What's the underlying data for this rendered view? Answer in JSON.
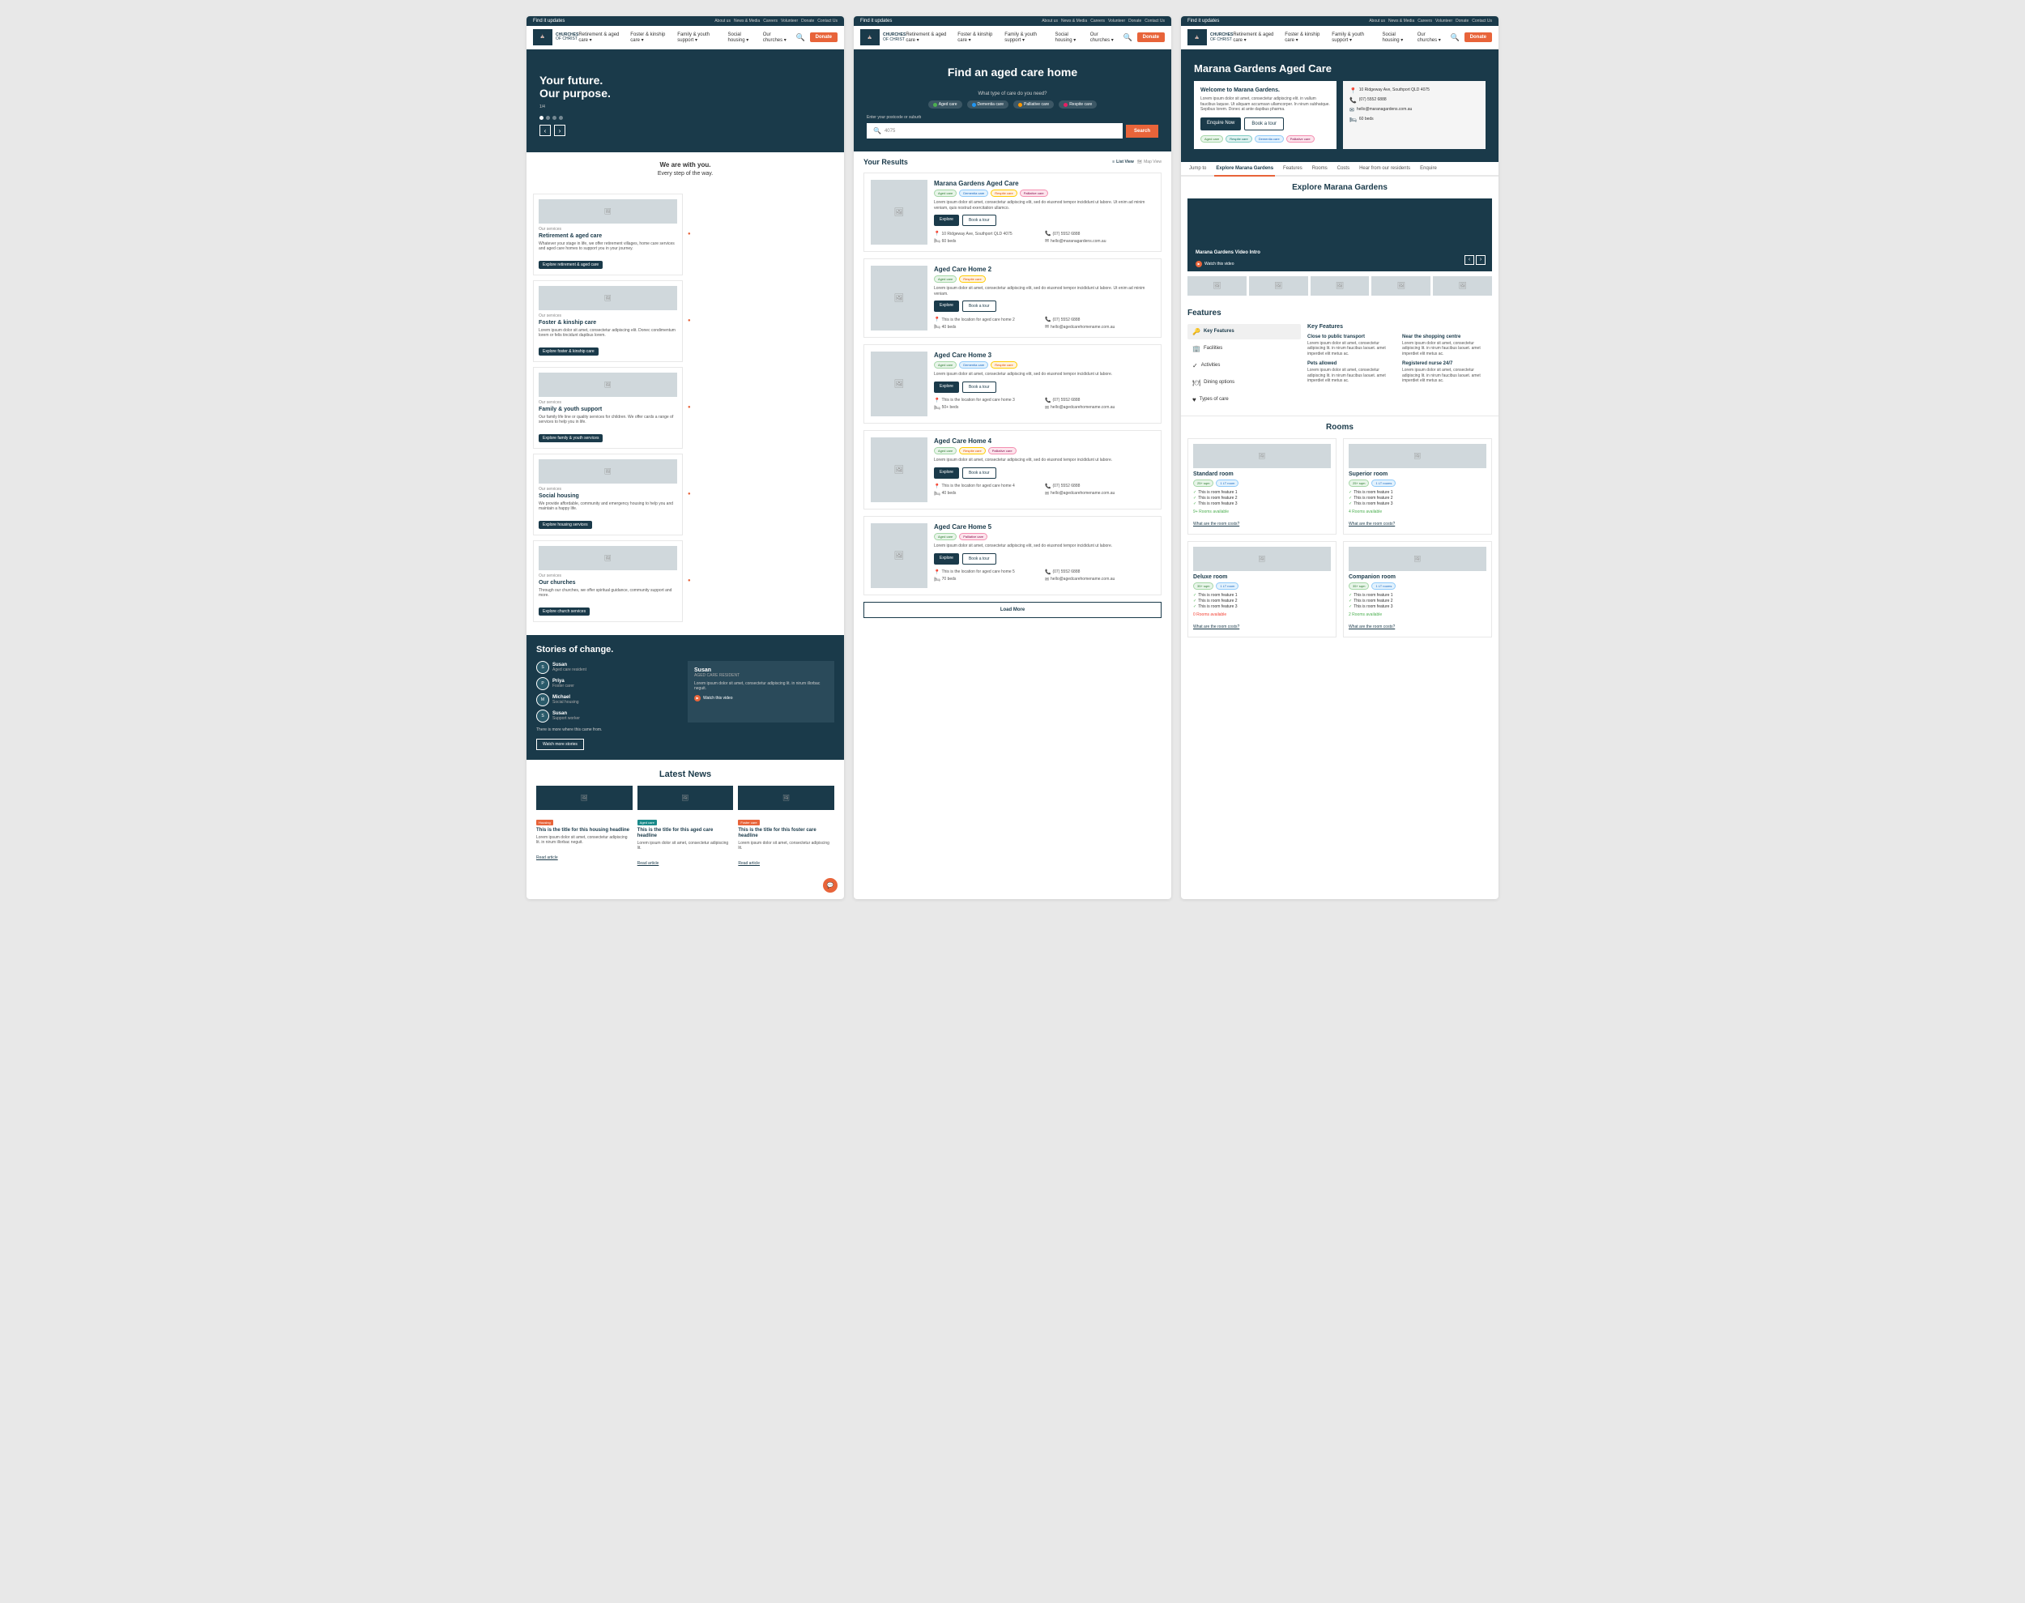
{
  "site": {
    "logo_text": "CHURCHES\nOF\nCHRIST",
    "nav_links": [
      "About us",
      "News & Media",
      "Careers",
      "Volunteer",
      "Donate",
      "Contact Us"
    ],
    "donate_btn": "Donate"
  },
  "panel1": {
    "top_bar": "Find it updates",
    "hero_title_line1": "Your future.",
    "hero_title_line2": "Our purpose.",
    "tagline_line1": "We are with you.",
    "tagline_line2": "Every step of the way.",
    "services": [
      {
        "label": "Our services",
        "title": "Retirement & aged care",
        "text": "Whatever your stage in life, we offer retirement villages, home care services and aged care homes to support you in your journey.",
        "btn": "Explore retirement & aged care"
      },
      {
        "label": "Our services",
        "title": "Foster & kinship care",
        "text": "Lorem ipsum dolor sit amet, consectetur adipiscing elit. Donec condimentum lorem or felis tincidunt dapibus lorem.",
        "btn": "Explore foster & kinship care"
      },
      {
        "label": "Our services",
        "title": "Family & youth support",
        "text": "Our family life line or quality services for children. We offer cards a range of services to help you in life.",
        "btn": "Explore family & youth services"
      },
      {
        "label": "Our services",
        "title": "Social housing",
        "text": "We provide affordable, community and emergency housing to help you and maintain a happy life.",
        "btn": "Explore housing services"
      },
      {
        "label": "Our services",
        "title": "Our churches",
        "text": "Through our churches, we offer spiritual guidance, community support and more.",
        "btn": "Explore church services"
      }
    ],
    "stories_title": "Stories of change.",
    "stories": [
      {
        "name": "Susan",
        "role": "Aged care resident"
      },
      {
        "name": "Priya",
        "role": "Foster carer"
      },
      {
        "name": "Michael",
        "role": "Social housing"
      },
      {
        "name": "Susan",
        "role": "Support worker"
      }
    ],
    "featured_story": {
      "name": "Susan",
      "role": "AGED CARE RESIDENT",
      "text": "Lorem ipsum dolor sit amet, consectetur adipiscing lit. in nirum illorbac neguit.",
      "watch_label": "Watch this video"
    },
    "more_stories_btn": "Watch more stories",
    "news_title": "Latest News",
    "news": [
      {
        "badge": "Housing",
        "badge_color": "orange",
        "headline": "This is the title for this housing headline",
        "text": "Lorem ipsum dolor sit amet, consectetur adipiscing lit. in nirum illorbac neguit.",
        "read_more": "Read article"
      },
      {
        "badge": "Aged care",
        "badge_color": "teal",
        "headline": "This is the title for this aged care headline",
        "text": "Lorem ipsum dolor sit amet, consectetur adipiscing lit.",
        "read_more": "Read article"
      },
      {
        "badge": "Foster care",
        "badge_color": "orange",
        "headline": "This is the title for this foster care headline",
        "text": "Lorem ipsum dolor sit amet, consectetur adipiscing lit.",
        "read_more": "Read article"
      }
    ]
  },
  "panel2": {
    "top_bar": "Find it updates",
    "hero_title": "Find an aged care home",
    "care_types": [
      "Aged care",
      "Dementia care",
      "Palliative care",
      "Respite care"
    ],
    "search_label": "Enter your postcode or suburb",
    "search_placeholder": "4075",
    "search_btn": "Search",
    "results_title": "Your Results",
    "view_list": "List View",
    "view_map": "Map View",
    "results": [
      {
        "title": "Marana Gardens Aged Care",
        "tags": [
          "Aged care",
          "Dementia care",
          "Respite care",
          "Palliative care"
        ],
        "text": "Lorem ipsum dolor sit amet, consectetur adipiscing elit, sed do eiusmod tempor incididunt ut labore. Ut enim ad minim veniam, quis nostrud exercitation ullamco.",
        "address": "10 Ridgeway Ave, Southport QLD 4075",
        "phone": "(07) 5552 6888",
        "email": "hello@maranagardens.com.au",
        "beds": "60 beds",
        "explore_btn": "Explore",
        "tour_btn": "Book a tour"
      },
      {
        "title": "Aged Care Home 2",
        "tags": [
          "Aged care",
          "Respite care"
        ],
        "text": "Lorem ipsum dolor sit amet, consectetur adipiscing elit, sed do eiusmod tempor incididunt ut labore. Ut enim ad minim veniam.",
        "address": "This is the location for aged care home 2",
        "phone": "(07) 5552 6888",
        "email": "hello@agedcarehomename.com.au",
        "beds": "40 beds",
        "explore_btn": "Explore",
        "tour_btn": "Book a tour"
      },
      {
        "title": "Aged Care Home 3",
        "tags": [
          "Aged care",
          "Dementia care",
          "Respite care"
        ],
        "text": "Lorem ipsum dolor sit amet, consectetur adipiscing elit, sed do eiusmod tempor incididunt ut labore.",
        "address": "This is the location for aged care home 3",
        "phone": "(07) 5552 6888",
        "email": "hello@agedcarehomename.com.au",
        "beds": "50+ beds",
        "explore_btn": "Explore",
        "tour_btn": "Book a tour"
      },
      {
        "title": "Aged Care Home 4",
        "tags": [
          "Aged care",
          "Respite care",
          "Palliative care"
        ],
        "text": "Lorem ipsum dolor sit amet, consectetur adipiscing elit, sed do eiusmod tempor incididunt ut labore.",
        "address": "This is the location for aged care home 4",
        "phone": "(07) 5552 6888",
        "email": "hello@agedcarehomename.com.au",
        "beds": "40 beds",
        "explore_btn": "Explore",
        "tour_btn": "Book a tour"
      },
      {
        "title": "Aged Care Home 5",
        "tags": [
          "Aged care",
          "Palliative care"
        ],
        "text": "Lorem ipsum dolor sit amet, consectetur adipiscing elit, sed do eiusmod tempor incididunt ut labore.",
        "address": "This is the location for aged care home 5",
        "phone": "(07) 5552 6888",
        "email": "hello@agedcarehomename.com.au",
        "beds": "70 beds",
        "explore_btn": "Explore",
        "tour_btn": "Book a tour"
      }
    ],
    "load_more_btn": "Load More"
  },
  "panel3": {
    "top_bar": "Find it updates",
    "detail_title": "Marana Gardens Aged Care",
    "welcome_title": "Welcome to Marana Gardens.",
    "welcome_text": "Lorem ipsum dolor sit amet, consectetur adipiscing elit. in vallum faucibus laquse. Ut aliquam accumsan ullamcorper. In nirum subhatque. Sepibus lorem. Donec at ante dapibus pharma.",
    "address": "10 Ridgeway Ave, Southport QLD 4075",
    "phone": "(07) 5552 6888",
    "email": "hello@maranagardens.com.au",
    "beds": "60 beds",
    "enquire_btn": "Enquire Now",
    "book_btn": "Book a tour",
    "care_tags": [
      "Aged care",
      "Respite care",
      "Dementia care",
      "Palliative care"
    ],
    "detail_nav": [
      "Jump to",
      "Explore Marana Gardens",
      "Features",
      "Rooms",
      "Costs",
      "Hear from our residents",
      "Enquire"
    ],
    "explore_title": "Explore Marana Gardens",
    "video_title": "Marana Gardens Video Intro",
    "watch_video": "Watch this video",
    "features_title": "Features",
    "features_sidebar": [
      "Key Features",
      "Facilities",
      "Activities",
      "Dining options",
      "Types of care"
    ],
    "features_content_title": "Key Features",
    "features": [
      {
        "title": "Close to public transport",
        "text": "Lorem ipsum dolor sit amet, consectetur adipiscing lit. in nirum faucibus laouet. amet imperdiet elit metus ac."
      },
      {
        "title": "Near the shopping centre",
        "text": "Lorem ipsum dolor sit amet, consectetur adipiscing lit. in nirum faucibus laouet. amet imperdiet elit metus ac."
      },
      {
        "title": "Pets allowed",
        "text": "Lorem ipsum dolor sit amet, consectetur adipiscing lit. in nirum faucibus laouet. amet imperdiet elit metus ac."
      },
      {
        "title": "Registered nurse 24/7",
        "text": "Lorem ipsum dolor sit amet, consectetur adipiscing lit. in nirum faucibus laouet. amet imperdiet elit metus ac."
      }
    ],
    "rooms_title": "Rooms",
    "rooms": [
      {
        "title": "Standard room",
        "tags": [
          "25+ sqm",
          "1 LT room"
        ],
        "features": [
          "This is room feature 1",
          "This is room feature 2",
          "This is room feature 3"
        ],
        "availability": "9+ Rooms available",
        "available": true,
        "link": "What are the room costs?"
      },
      {
        "title": "Superior room",
        "tags": [
          "25+ sqm",
          "1 LT rooms"
        ],
        "features": [
          "This is room feature 1",
          "This is room feature 2",
          "This is room feature 3"
        ],
        "availability": "4 Rooms available",
        "available": true,
        "link": "What are the room costs?"
      },
      {
        "title": "Deluxe room",
        "tags": [
          "35+ sqm",
          "1 LT room"
        ],
        "features": [
          "This is room feature 1",
          "This is room feature 2",
          "This is room feature 3"
        ],
        "availability": "0 Rooms available",
        "available": false,
        "link": "What are the room costs?"
      },
      {
        "title": "Companion room",
        "tags": [
          "35+ sqm",
          "1 LT rooms"
        ],
        "features": [
          "This is room feature 1",
          "This is room feature 2",
          "This is room feature 3"
        ],
        "availability": "2 Rooms available",
        "available": true,
        "link": "What are the room costs?"
      }
    ]
  }
}
